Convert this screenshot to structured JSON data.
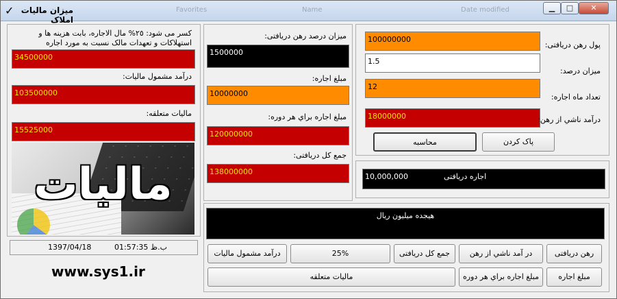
{
  "window": {
    "title": "میزان مالیات املاک",
    "ghost_favorites": "Favorites",
    "ghost_name": "Name",
    "ghost_date": "Date modified"
  },
  "mortgage_panel": {
    "received_mortgage_label": "پول رهن دریافتی:",
    "received_mortgage_value": "100000000",
    "percent_label": "میزان درصد:",
    "percent_value": "1.5",
    "rent_months_label": "تعداد ماه اجاره:",
    "rent_months_value": "12",
    "mortgage_income_label": "درآمد ناشي از رهن:",
    "mortgage_income_value": "18000000",
    "calculate_label": "محاسبه",
    "clear_label": "پاک کردن"
  },
  "rent_panel": {
    "mortgage_percent_label": "میزان درصد رهن دریافتی:",
    "mortgage_percent_value": "1500000",
    "rent_amount_label": "مبلغ اجاره:",
    "rent_amount_value": "10000000",
    "rent_per_period_label": "مبلغ اجاره براي هر دوره:",
    "rent_per_period_value": "120000000",
    "total_received_label": "جمع کل دریافتی:",
    "total_received_value": "138000000"
  },
  "tax_panel": {
    "deduction_text": "کسر می شود: ٢٥% مال الاجاره، بابت هزینه ها و استهلاکات و تعهدات مالک نسبت به مورد اجاره",
    "deduction_value": "34500000",
    "taxable_income_label": "درآمد مشمول مالیات:",
    "taxable_income_value": "103500000",
    "tax_due_label": "مالیات متعلقه:",
    "tax_due_value": "15525000",
    "image_word": "مالیات"
  },
  "status": {
    "time": "01:57:35 ب.ظ",
    "date": "1397/04/18"
  },
  "website": "www.sys1.ir",
  "rent_display": {
    "value": "10,000,000",
    "label": "اجاره دریافتی"
  },
  "words_display": {
    "text": "هیجده میلیون  ریال"
  },
  "bottom_buttons": {
    "received_mortgage": "رهن دریافتی",
    "mortgage_income": "در آمد ناشي از رهن",
    "total_received": "جمع کل دریافتی",
    "percent": "25%",
    "taxable_income": "درآمد مشمول مالیات",
    "rent_amount": "مبلغ اجاره",
    "rent_per_period": "مبلغ اجاره براي هر دوره",
    "tax_due": "مالیات متعلقه"
  },
  "colors": {
    "red_field": "#c40000",
    "orange_field": "#ff8c00",
    "black_field": "#000000",
    "yellow_text": "#ffe100"
  }
}
